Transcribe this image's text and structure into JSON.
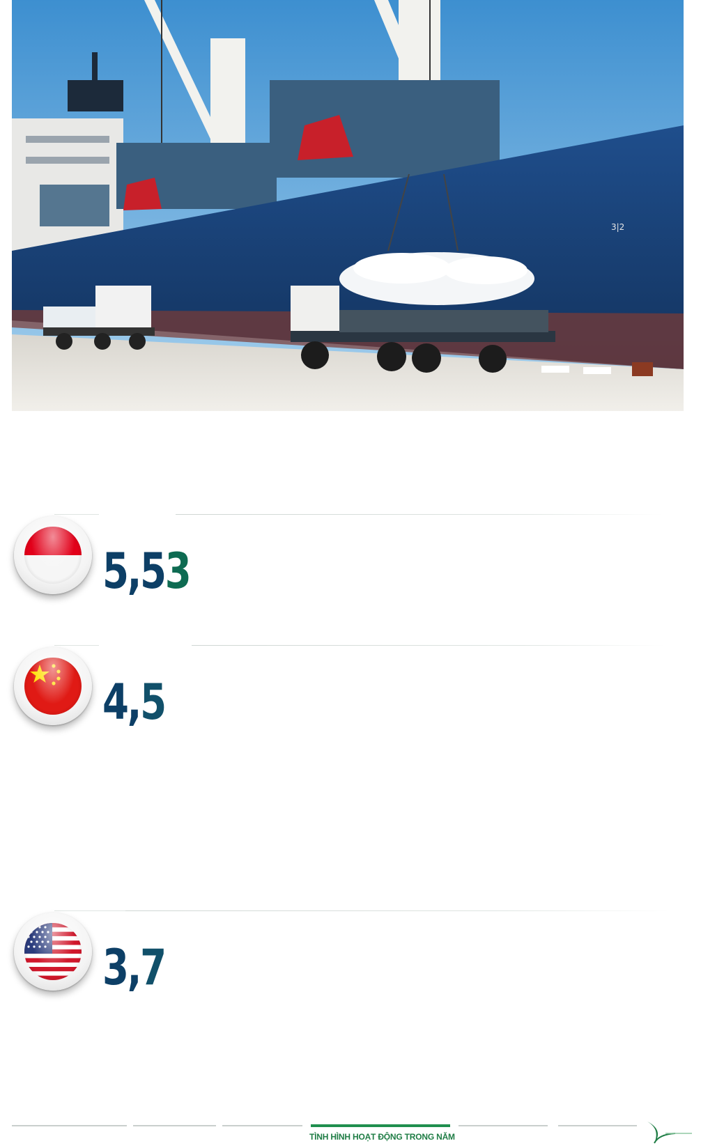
{
  "hero": {
    "image": "cargo-ship-loading-rice-bags-onto-trucks",
    "hull_mark": "3|2"
  },
  "stats": [
    {
      "country": "Indonesia",
      "flag": "indonesia-flag-icon",
      "value_main": "5,5",
      "value_tail": "3"
    },
    {
      "country": "China",
      "flag": "china-flag-icon",
      "value_main": "4,",
      "value_tail": "5"
    },
    {
      "country": "United States",
      "flag": "usa-flag-icon",
      "value_main": "3,",
      "value_tail": "7"
    }
  ],
  "footer": {
    "section_label": "TÌNH HÌNH HOẠT ĐỘNG TRONG NĂM",
    "logo_icon": "company-leaf-logo-icon",
    "colors": {
      "active": "#1f8f4e",
      "inactive": "#c9cfcd"
    }
  },
  "colors": {
    "value_navy": "#0d3f66",
    "value_green": "#0e6b52"
  }
}
